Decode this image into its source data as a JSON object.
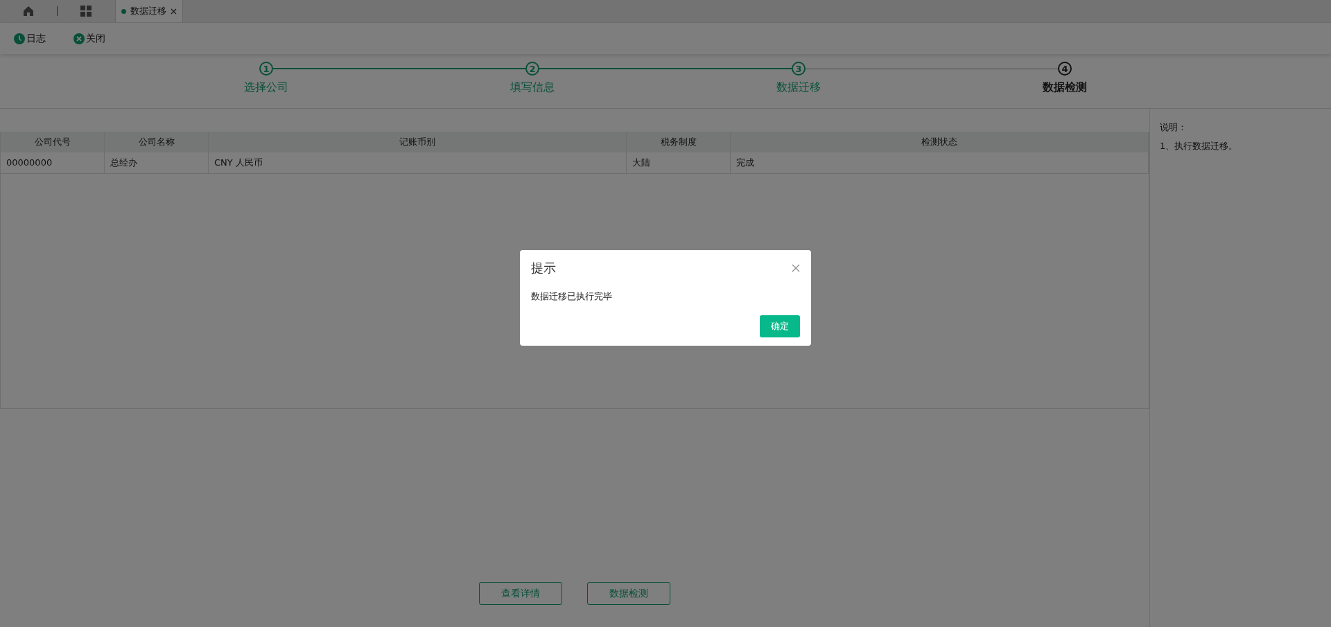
{
  "tabs": [
    {
      "kind": "home",
      "selected": false
    },
    {
      "kind": "apps",
      "selected": false
    },
    {
      "kind": "page",
      "label": "数据迁移",
      "selected": true
    }
  ],
  "toolbar": [
    {
      "kind": "clock",
      "label": "日志"
    },
    {
      "kind": "close",
      "label": "关闭"
    }
  ],
  "steps": [
    {
      "number": "1",
      "label": "选择公司",
      "done": true
    },
    {
      "number": "2",
      "label": "填写信息",
      "done": true
    },
    {
      "number": "3",
      "label": "数据迁移",
      "done": true
    },
    {
      "number": "4",
      "label": "数据检测",
      "done": false
    }
  ],
  "table": {
    "columns": [
      "公司代号",
      "公司名称",
      "记账币别",
      "税务制度",
      "检测状态"
    ],
    "rows": [
      [
        "00000000",
        "总经办",
        "CNY 人民币",
        "大陆",
        "完成"
      ]
    ]
  },
  "buttons": [
    "查看详情",
    "数据检测"
  ],
  "notes": {
    "title": "说明：",
    "lines": [
      "1、执行数据迁移。"
    ]
  },
  "dialog": {
    "title": "提示",
    "message": "数据迁移已执行完毕",
    "confirm": "确定"
  }
}
